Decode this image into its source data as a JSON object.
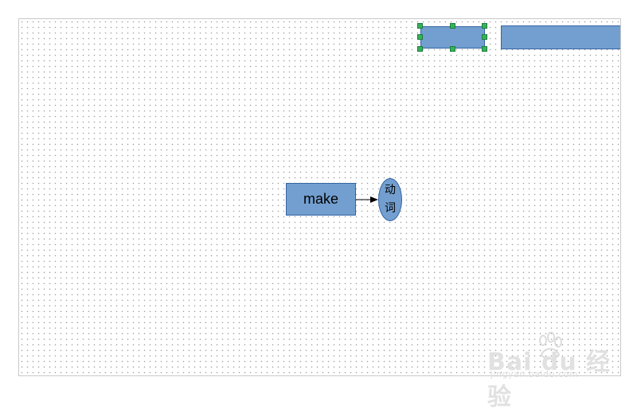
{
  "diagram": {
    "nodes": {
      "make_label": "make",
      "ellipse_line1": "动",
      "ellipse_line2": "词"
    }
  },
  "colors": {
    "shape_fill": "#729fcf",
    "shape_border": "#3465a4",
    "selection_handle": "#35b35a",
    "grid_dot": "#9a9a9a"
  },
  "watermark": {
    "brand": "Bai du 经验",
    "url": "jingyan.baidu.com"
  }
}
